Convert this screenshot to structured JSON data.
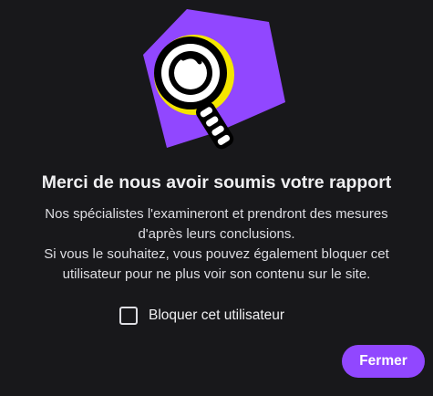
{
  "dialog": {
    "title": "Merci de nous avoir soumis votre rapport",
    "message_line1": "Nos spécialistes l'examineront et prendront des mesures",
    "message_line2": "d'après leurs conclusions.",
    "message_line3": "Si vous le souhaitez, vous pouvez également bloquer cet",
    "message_line4": "utilisateur pour ne plus voir son contenu sur le site.",
    "block_checkbox_label": "Bloquer cet utilisateur",
    "block_checkbox_checked": false,
    "close_button_label": "Fermer",
    "illustration_icon": "magnifying-glass-icon"
  },
  "colors": {
    "background": "#18181b",
    "accent": "#9147ff",
    "highlight": "#f4e600",
    "text": "#efeff1"
  }
}
